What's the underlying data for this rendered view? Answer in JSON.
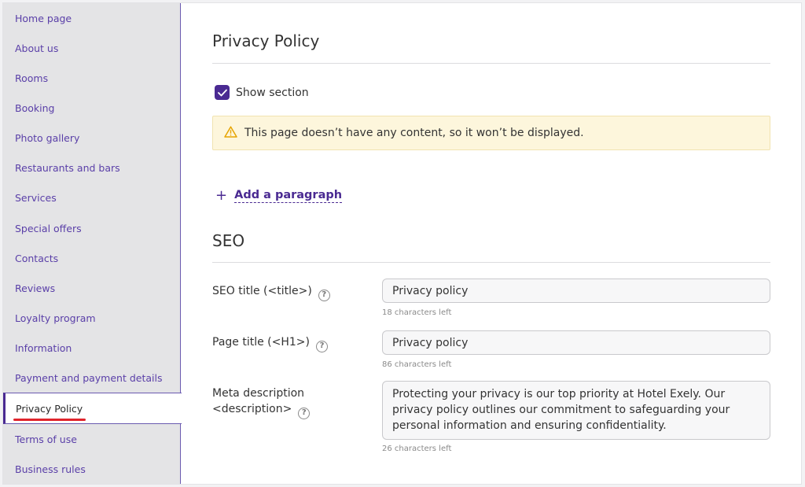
{
  "sidebar": {
    "items": [
      {
        "label": "Home page"
      },
      {
        "label": "About us"
      },
      {
        "label": "Rooms"
      },
      {
        "label": "Booking"
      },
      {
        "label": "Photo gallery"
      },
      {
        "label": "Restaurants and bars"
      },
      {
        "label": "Services"
      },
      {
        "label": "Special offers"
      },
      {
        "label": "Contacts"
      },
      {
        "label": "Reviews"
      },
      {
        "label": "Loyalty program"
      },
      {
        "label": "Information"
      },
      {
        "label": "Payment and payment details"
      },
      {
        "label": "Privacy Policy",
        "active": true
      },
      {
        "label": "Terms of use"
      },
      {
        "label": "Business rules"
      }
    ]
  },
  "main": {
    "title": "Privacy Policy",
    "show_section": {
      "label": "Show section",
      "checked": true
    },
    "alert": {
      "text": "This page doesn’t have any content, so it won’t be displayed.",
      "icon": "warning-icon"
    },
    "add_paragraph": {
      "label": "Add a paragraph",
      "icon": "plus-icon"
    },
    "seo": {
      "heading": "SEO",
      "seo_title": {
        "label": "SEO title (<title>)",
        "value": "Privacy policy",
        "counter": "18 characters left"
      },
      "page_title": {
        "label": "Page title (<H1>)",
        "value": "Privacy policy",
        "counter": "86 characters left"
      },
      "meta_description": {
        "label_line1": "Meta description",
        "label_line2": "<description>",
        "value": "Protecting your privacy is our top priority at Hotel Exely. Our privacy policy outlines our commitment to safeguarding your personal information and ensuring confidentiality.",
        "counter": "26 characters left"
      }
    }
  },
  "colors": {
    "accent": "#4a2a92",
    "sidebar_bg": "#e4e4e6",
    "alert_bg": "#fdf6dc",
    "underline_red": "#e0242c"
  }
}
